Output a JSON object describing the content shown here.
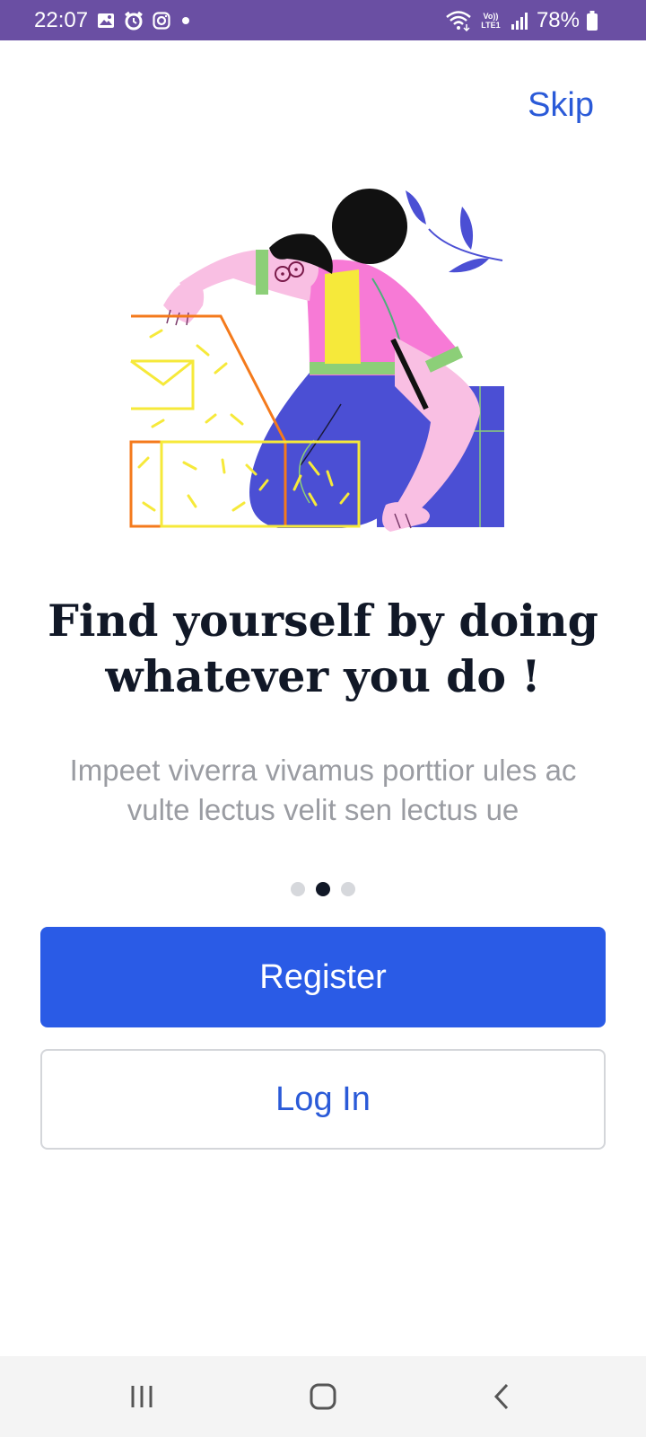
{
  "status_bar": {
    "time": "22:07",
    "battery": "78%",
    "network_label": "Vo)) LTE1",
    "notification_icons": [
      "gallery-icon",
      "alarm-icon",
      "instagram-icon",
      "dot-icon"
    ],
    "system_icons": [
      "wifi-icon",
      "lte-icon",
      "signal-icon",
      "battery-icon"
    ],
    "background_color": "#6a4fa3"
  },
  "header": {
    "skip_label": "Skip"
  },
  "onboarding": {
    "headline": "Find yourself  by doing whatever you do !",
    "description": "Impeet viverra vivamus porttior ules ac vulte lectus velit sen lectus ue",
    "page_indicator": {
      "total": 3,
      "current": 2
    }
  },
  "actions": {
    "register_label": "Register",
    "login_label": "Log In"
  },
  "colors": {
    "primary": "#2a5be6",
    "link": "#2a5ad8",
    "headline": "#111827",
    "muted_text": "#9a9ca2"
  },
  "navigation_bar": {
    "buttons": [
      "recent-apps-icon",
      "home-icon",
      "back-icon"
    ]
  }
}
